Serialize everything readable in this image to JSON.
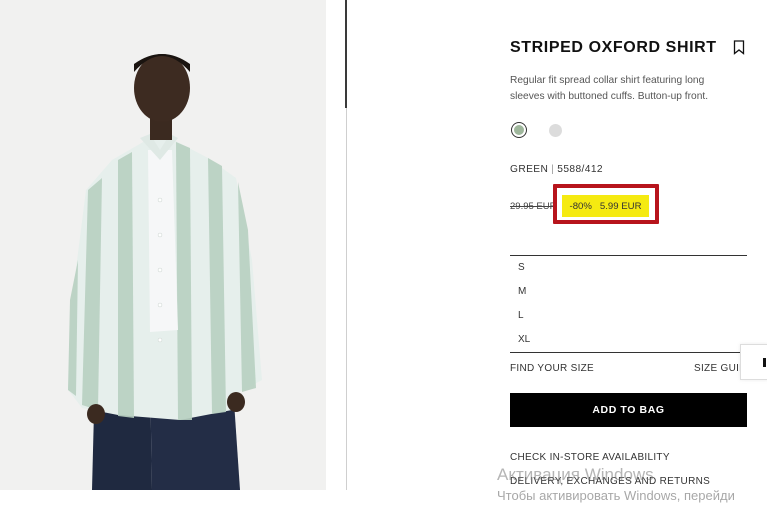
{
  "product": {
    "title": "STRIPED OXFORD SHIRT",
    "description": "Regular fit spread collar shirt featuring long sleeves with buttoned cuffs. Button-up front.",
    "color_name": "GREEN",
    "color_separator": "|",
    "reference": "5588/412",
    "colors": [
      {
        "name": "green",
        "hex": "#9fb79c",
        "selected": true
      },
      {
        "name": "white",
        "hex": "#dcdcdc",
        "selected": false
      }
    ]
  },
  "pricing": {
    "old_price": "29.95 EUR",
    "discount": "-80%",
    "new_price": "5.99 EUR",
    "highlight_color": "#f5ea11",
    "annotation_border_color": "#b7141c"
  },
  "sizes": [
    "S",
    "M",
    "L",
    "XL"
  ],
  "links": {
    "find_your_size": "FIND YOUR SIZE",
    "size_guide": "SIZE GUID",
    "check_store": "CHECK IN-STORE AVAILABILITY",
    "delivery": "DELIVERY, EXCHANGES AND RETURNS"
  },
  "actions": {
    "add_to_bag": "ADD TO BAG"
  },
  "icons": {
    "bookmark": "bookmark-icon"
  },
  "watermark": {
    "line1": "Активация Windows",
    "line2": "Чтобы активировать Windows, перейди"
  }
}
